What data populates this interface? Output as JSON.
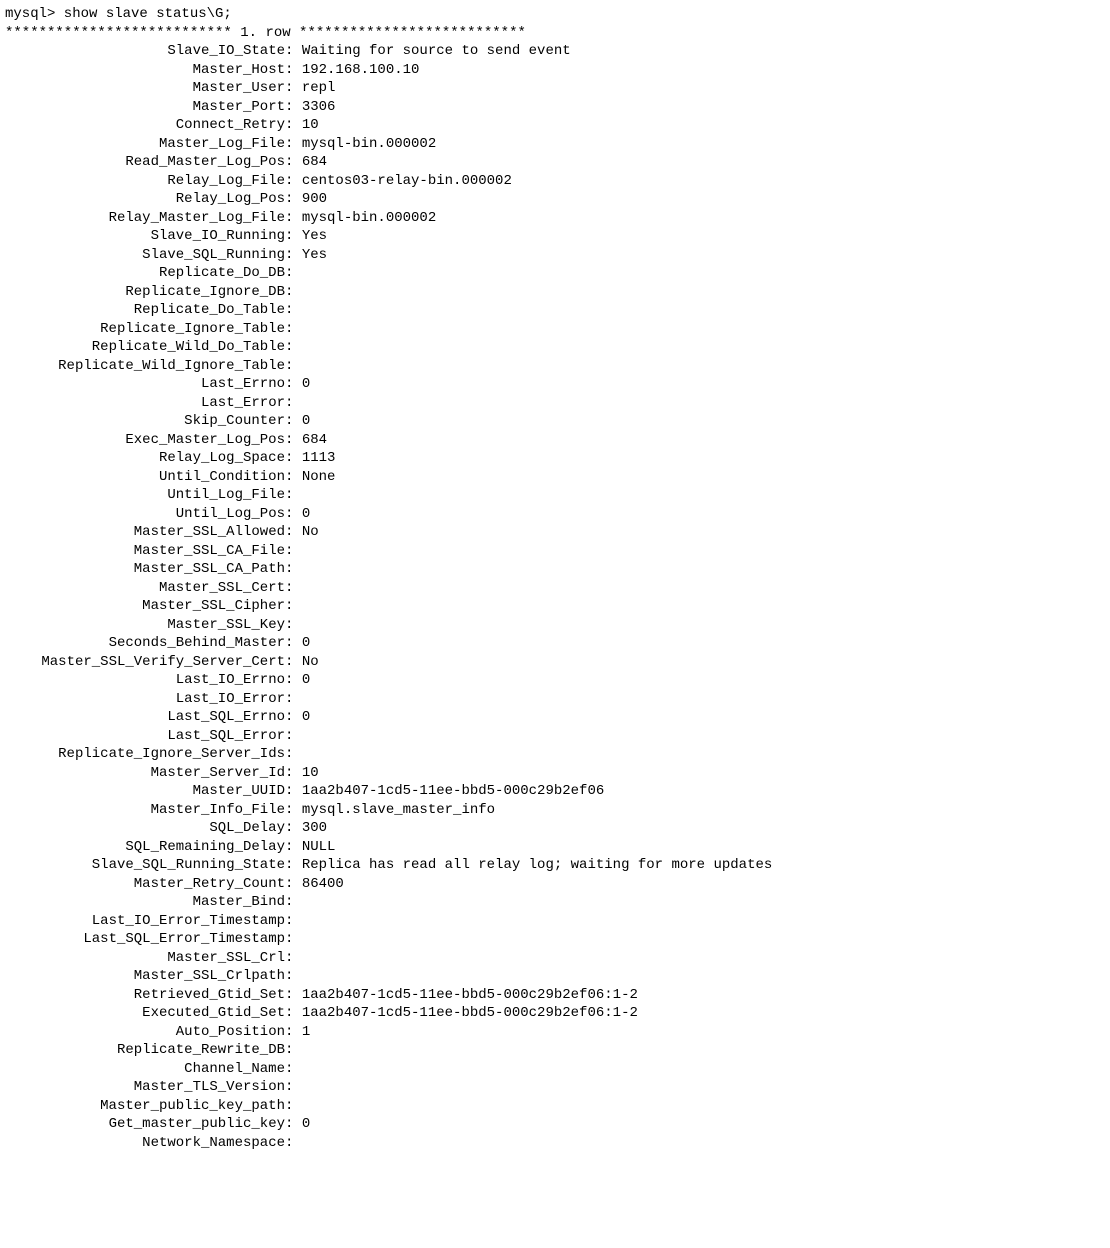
{
  "prompt": "mysql> show slave status\\G;",
  "row_header": "*************************** 1. row ***************************",
  "fields": [
    {
      "label": "Slave_IO_State",
      "value": "Waiting for source to send event"
    },
    {
      "label": "Master_Host",
      "value": "192.168.100.10"
    },
    {
      "label": "Master_User",
      "value": "repl"
    },
    {
      "label": "Master_Port",
      "value": "3306"
    },
    {
      "label": "Connect_Retry",
      "value": "10"
    },
    {
      "label": "Master_Log_File",
      "value": "mysql-bin.000002"
    },
    {
      "label": "Read_Master_Log_Pos",
      "value": "684"
    },
    {
      "label": "Relay_Log_File",
      "value": "centos03-relay-bin.000002"
    },
    {
      "label": "Relay_Log_Pos",
      "value": "900"
    },
    {
      "label": "Relay_Master_Log_File",
      "value": "mysql-bin.000002"
    },
    {
      "label": "Slave_IO_Running",
      "value": "Yes"
    },
    {
      "label": "Slave_SQL_Running",
      "value": "Yes"
    },
    {
      "label": "Replicate_Do_DB",
      "value": ""
    },
    {
      "label": "Replicate_Ignore_DB",
      "value": ""
    },
    {
      "label": "Replicate_Do_Table",
      "value": ""
    },
    {
      "label": "Replicate_Ignore_Table",
      "value": ""
    },
    {
      "label": "Replicate_Wild_Do_Table",
      "value": ""
    },
    {
      "label": "Replicate_Wild_Ignore_Table",
      "value": ""
    },
    {
      "label": "Last_Errno",
      "value": "0"
    },
    {
      "label": "Last_Error",
      "value": ""
    },
    {
      "label": "Skip_Counter",
      "value": "0"
    },
    {
      "label": "Exec_Master_Log_Pos",
      "value": "684"
    },
    {
      "label": "Relay_Log_Space",
      "value": "1113"
    },
    {
      "label": "Until_Condition",
      "value": "None"
    },
    {
      "label": "Until_Log_File",
      "value": ""
    },
    {
      "label": "Until_Log_Pos",
      "value": "0"
    },
    {
      "label": "Master_SSL_Allowed",
      "value": "No"
    },
    {
      "label": "Master_SSL_CA_File",
      "value": ""
    },
    {
      "label": "Master_SSL_CA_Path",
      "value": ""
    },
    {
      "label": "Master_SSL_Cert",
      "value": ""
    },
    {
      "label": "Master_SSL_Cipher",
      "value": ""
    },
    {
      "label": "Master_SSL_Key",
      "value": ""
    },
    {
      "label": "Seconds_Behind_Master",
      "value": "0"
    },
    {
      "label": "Master_SSL_Verify_Server_Cert",
      "value": "No"
    },
    {
      "label": "Last_IO_Errno",
      "value": "0"
    },
    {
      "label": "Last_IO_Error",
      "value": ""
    },
    {
      "label": "Last_SQL_Errno",
      "value": "0"
    },
    {
      "label": "Last_SQL_Error",
      "value": ""
    },
    {
      "label": "Replicate_Ignore_Server_Ids",
      "value": ""
    },
    {
      "label": "Master_Server_Id",
      "value": "10"
    },
    {
      "label": "Master_UUID",
      "value": "1aa2b407-1cd5-11ee-bbd5-000c29b2ef06"
    },
    {
      "label": "Master_Info_File",
      "value": "mysql.slave_master_info"
    },
    {
      "label": "SQL_Delay",
      "value": "300"
    },
    {
      "label": "SQL_Remaining_Delay",
      "value": "NULL"
    },
    {
      "label": "Slave_SQL_Running_State",
      "value": "Replica has read all relay log; waiting for more updates"
    },
    {
      "label": "Master_Retry_Count",
      "value": "86400"
    },
    {
      "label": "Master_Bind",
      "value": ""
    },
    {
      "label": "Last_IO_Error_Timestamp",
      "value": ""
    },
    {
      "label": "Last_SQL_Error_Timestamp",
      "value": ""
    },
    {
      "label": "Master_SSL_Crl",
      "value": ""
    },
    {
      "label": "Master_SSL_Crlpath",
      "value": ""
    },
    {
      "label": "Retrieved_Gtid_Set",
      "value": "1aa2b407-1cd5-11ee-bbd5-000c29b2ef06:1-2"
    },
    {
      "label": "Executed_Gtid_Set",
      "value": "1aa2b407-1cd5-11ee-bbd5-000c29b2ef06:1-2"
    },
    {
      "label": "Auto_Position",
      "value": "1"
    },
    {
      "label": "Replicate_Rewrite_DB",
      "value": ""
    },
    {
      "label": "Channel_Name",
      "value": ""
    },
    {
      "label": "Master_TLS_Version",
      "value": ""
    },
    {
      "label": "Master_public_key_path",
      "value": ""
    },
    {
      "label": "Get_master_public_key",
      "value": "0"
    },
    {
      "label": "Network_Namespace",
      "value": ""
    }
  ],
  "separator": ": "
}
